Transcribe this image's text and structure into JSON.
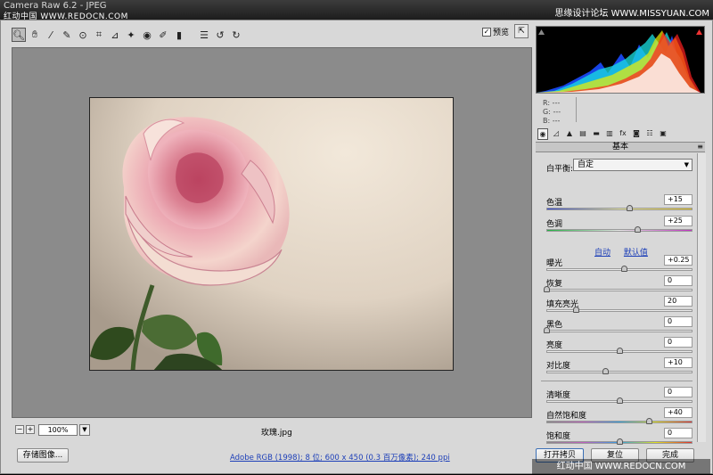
{
  "window": {
    "title": "Camera Raw 6.2 - JPEG",
    "watermark_top_left": "红动中国 WWW.REDOCN.COM",
    "watermark_top_right": "思缘设计论坛 WWW.MISSYUAN.COM"
  },
  "toolbar": {
    "tools": [
      {
        "name": "zoom-tool-icon",
        "glyph": "🔍︎"
      },
      {
        "name": "hand-tool-icon",
        "glyph": "✋︎"
      },
      {
        "name": "white-balance-tool-icon",
        "glyph": "⁄"
      },
      {
        "name": "color-sampler-tool-icon",
        "glyph": "✎"
      },
      {
        "name": "targeted-adjustment-tool-icon",
        "glyph": "⊙"
      },
      {
        "name": "crop-tool-icon",
        "glyph": "⌗"
      },
      {
        "name": "straighten-tool-icon",
        "glyph": "⊿"
      },
      {
        "name": "spot-removal-tool-icon",
        "glyph": "✦"
      },
      {
        "name": "red-eye-tool-icon",
        "glyph": "◉"
      },
      {
        "name": "adjustment-brush-icon",
        "glyph": "✐"
      },
      {
        "name": "graduated-filter-icon",
        "glyph": "▮"
      },
      {
        "name": "preferences-icon",
        "glyph": "☰"
      },
      {
        "name": "rotate-ccw-icon",
        "glyph": "↺"
      },
      {
        "name": "rotate-cw-icon",
        "glyph": "↻"
      }
    ],
    "preview_label": "预览",
    "preview_checked": "✓"
  },
  "canvas": {
    "zoom": "100%",
    "filename": "玫瑰.jpg"
  },
  "histogram": {
    "r": "R:  ---",
    "g": "G:  ---",
    "b": "B:  ---"
  },
  "panel": {
    "title": "基本",
    "white_balance_label": "白平衡:",
    "white_balance_value": "自定",
    "auto_link": "自动",
    "default_link": "默认值",
    "sliders": [
      {
        "id": "temperature",
        "label": "色温",
        "value": "+15",
        "pos": 0.57,
        "track": "linear-gradient(90deg,#2a3fd0,#e8e8a0,#e0c020)"
      },
      {
        "id": "tint",
        "label": "色调",
        "value": "+25",
        "pos": 0.62,
        "track": "linear-gradient(90deg,#20b040,#e8e8e8,#c030c0)"
      },
      {
        "id": "exposure",
        "label": "曝光",
        "value": "+0.25",
        "pos": 0.53,
        "track": "#ececec"
      },
      {
        "id": "recovery",
        "label": "恢复",
        "value": "0",
        "pos": 0.0,
        "track": "#ececec"
      },
      {
        "id": "fill-light",
        "label": "填充亮光",
        "value": "20",
        "pos": 0.2,
        "track": "#ececec"
      },
      {
        "id": "blacks",
        "label": "黑色",
        "value": "0",
        "pos": 0.0,
        "track": "#ececec"
      },
      {
        "id": "brightness",
        "label": "亮度",
        "value": "0",
        "pos": 0.5,
        "track": "#ececec"
      },
      {
        "id": "contrast",
        "label": "对比度",
        "value": "+10",
        "pos": 0.4,
        "track": "#ececec"
      },
      {
        "id": "clarity",
        "label": "清晰度",
        "value": "0",
        "pos": 0.5,
        "track": "#ececec"
      },
      {
        "id": "vibrance",
        "label": "自然饱和度",
        "value": "+40",
        "pos": 0.7,
        "track": "linear-gradient(90deg,#888,#c060c0,#30a0e0,#e0e020,#e03030)"
      },
      {
        "id": "saturation",
        "label": "饱和度",
        "value": "0",
        "pos": 0.5,
        "track": "linear-gradient(90deg,#888,#c060c0,#30a0e0,#e0e020,#e03030)"
      }
    ]
  },
  "footer": {
    "save_label": "存储图像...",
    "workflow_link": "Adobe RGB (1998); 8 位; 600 x 450 (0.3 百万像素); 240 ppi",
    "open_label": "打开拷贝",
    "reset_label": "复位",
    "done_label": "完成",
    "watermark": "红动中国 WWW.REDOCN.COM"
  }
}
